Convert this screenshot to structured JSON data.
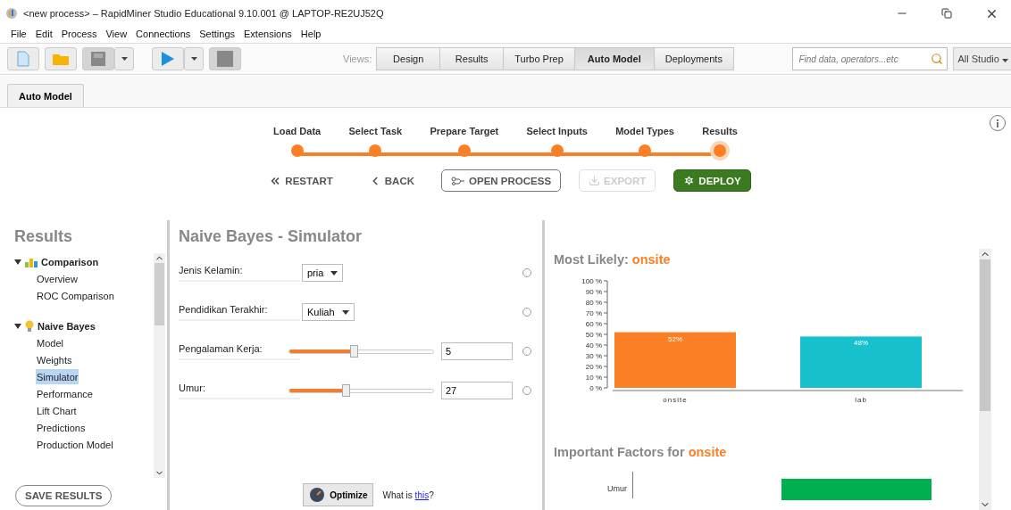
{
  "window": {
    "title": "<new process> – RapidMiner Studio Educational 9.10.001 @ LAPTOP-RE2UJ52Q"
  },
  "menu": [
    "File",
    "Edit",
    "Process",
    "View",
    "Connections",
    "Settings",
    "Extensions",
    "Help"
  ],
  "toolbar": {
    "views_label": "Views:",
    "views": [
      {
        "label": "Design",
        "selected": false
      },
      {
        "label": "Results",
        "selected": false
      },
      {
        "label": "Turbo Prep",
        "selected": false
      },
      {
        "label": "Auto Model",
        "selected": true
      },
      {
        "label": "Deployments",
        "selected": false
      }
    ],
    "search": {
      "placeholder": "Find data, operators...etc"
    },
    "scope": "All Studio"
  },
  "tabs": [
    {
      "label": "Auto Model",
      "selected": true
    }
  ],
  "wizard": {
    "steps": [
      {
        "label": "Load Data",
        "selected": false
      },
      {
        "label": "Select Task",
        "selected": false
      },
      {
        "label": "Prepare Target",
        "selected": false
      },
      {
        "label": "Select Inputs",
        "selected": false
      },
      {
        "label": "Model Types",
        "selected": false
      },
      {
        "label": "Results",
        "selected": true
      }
    ],
    "actions": [
      {
        "label": "RESTART",
        "kind": "restart",
        "disabled": false
      },
      {
        "label": "BACK",
        "kind": "back",
        "disabled": false
      },
      {
        "label": "OPEN PROCESS",
        "kind": "open",
        "disabled": false
      },
      {
        "label": "EXPORT",
        "kind": "export",
        "disabled": true
      },
      {
        "label": "DEPLOY",
        "kind": "deploy",
        "disabled": false
      }
    ]
  },
  "sidebar": {
    "title": "Results",
    "groups": [
      {
        "label": "Comparison",
        "expanded": true,
        "children": [
          {
            "label": "Overview",
            "selected": false
          },
          {
            "label": "ROC Comparison",
            "selected": false
          }
        ]
      },
      {
        "label": "Naive Bayes",
        "expanded": true,
        "children": [
          {
            "label": "Model",
            "selected": false
          },
          {
            "label": "Weights",
            "selected": false
          },
          {
            "label": "Simulator",
            "selected": true
          },
          {
            "label": "Performance",
            "selected": false
          },
          {
            "label": "Lift Chart",
            "selected": false
          },
          {
            "label": "Predictions",
            "selected": false
          },
          {
            "label": "Production Model",
            "selected": false
          }
        ]
      }
    ],
    "save_button": "SAVE RESULTS"
  },
  "simulator": {
    "title": "Naive Bayes - Simulator",
    "inputs": [
      {
        "kind": "dropdown",
        "label": "Jenis Kelamin:",
        "value": "pria"
      },
      {
        "kind": "dropdown",
        "label": "Pendidikan Terakhir:",
        "value": "Kuliah"
      },
      {
        "kind": "slider",
        "label": "Pengalaman Kerja:",
        "value": "5",
        "level": 0.45
      },
      {
        "kind": "slider",
        "label": "Umur:",
        "value": "27",
        "level": 0.39
      }
    ],
    "optimize": "Optimize",
    "help_prefix": "What is",
    "help_link": "this",
    "help_suffix": "?"
  },
  "most_likely": {
    "label": "Most Likely:",
    "value": "onsite",
    "chart_data": {
      "type": "bar",
      "categories": [
        "onsite",
        "lab"
      ],
      "series": [
        {
          "color": "#fb7f24",
          "values": [
            52,
            null
          ]
        },
        {
          "color": "#16c0cc",
          "values": [
            null,
            48
          ]
        }
      ],
      "ylim": [
        0,
        100
      ],
      "yticks": [
        {
          "value": 0,
          "label": "0 %"
        },
        {
          "value": 10,
          "label": "10 %"
        },
        {
          "value": 20,
          "label": "20 %"
        },
        {
          "value": 30,
          "label": "30 %"
        },
        {
          "value": 40,
          "label": "40 %"
        },
        {
          "value": 50,
          "label": "50 %"
        },
        {
          "value": 60,
          "label": "60 %"
        },
        {
          "value": 70,
          "label": "70 %"
        },
        {
          "value": 80,
          "label": "80 %"
        },
        {
          "value": 90,
          "label": "90 %"
        },
        {
          "value": 100,
          "label": "100 %"
        }
      ],
      "value_labels": [
        "52%",
        "48%"
      ]
    }
  },
  "important_factors": {
    "label": "Important Factors for",
    "value": "onsite",
    "factor_label": "Umur"
  }
}
